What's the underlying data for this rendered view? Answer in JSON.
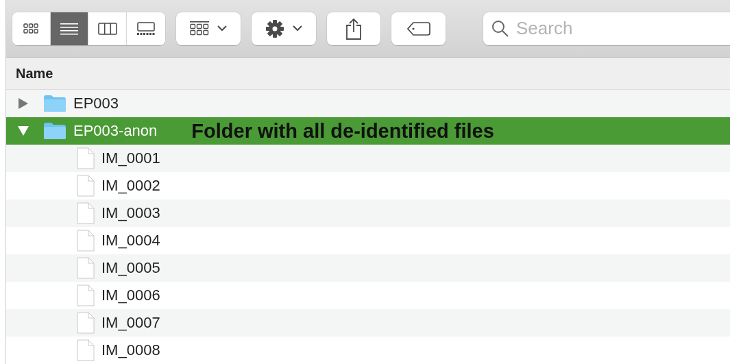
{
  "toolbar": {
    "view_modes": [
      {
        "kind": "icons",
        "selected": false
      },
      {
        "kind": "list",
        "selected": true
      },
      {
        "kind": "columns",
        "selected": false
      },
      {
        "kind": "gallery",
        "selected": false
      }
    ],
    "search": {
      "placeholder": "Search"
    }
  },
  "columns": [
    {
      "label": "Name"
    }
  ],
  "tree": [
    {
      "name": "EP003",
      "kind": "folder",
      "expanded": false,
      "selected": false
    },
    {
      "name": "EP003-anon",
      "kind": "folder",
      "expanded": true,
      "selected": true,
      "annotation": "Folder with all de-identified files",
      "children": [
        {
          "name": "IM_0001",
          "kind": "file",
          "selected": false
        },
        {
          "name": "IM_0002",
          "kind": "file",
          "selected": false
        },
        {
          "name": "IM_0003",
          "kind": "file",
          "selected": false
        },
        {
          "name": "IM_0004",
          "kind": "file",
          "selected": false
        },
        {
          "name": "IM_0005",
          "kind": "file",
          "selected": false
        },
        {
          "name": "IM_0006",
          "kind": "file",
          "selected": false
        },
        {
          "name": "IM_0007",
          "kind": "file",
          "selected": false
        },
        {
          "name": "IM_0008",
          "kind": "file",
          "selected": false
        }
      ]
    }
  ]
}
